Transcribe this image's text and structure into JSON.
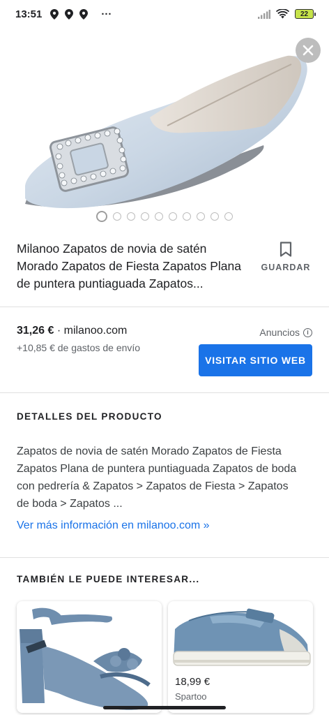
{
  "status_bar": {
    "time": "13:51",
    "more": "···",
    "battery": "22",
    "left_icons": [
      "location-pin-icon",
      "location-pin-icon",
      "location-pin-icon"
    ],
    "right_icons": [
      "signal-icon",
      "wifi-icon",
      "battery-icon"
    ]
  },
  "hero": {
    "image": "light-blue satin flat shoe with crystal buckle",
    "slide_count": 10,
    "active_slide": 1
  },
  "product": {
    "title": "Milanoo Zapatos de novia de satén Morado Zapatos de Fiesta Zapatos Plana de puntera puntiaguada Zapatos...",
    "save_label": "GUARDAR"
  },
  "offer": {
    "price": "31,26 €",
    "separator": " · ",
    "store": "milanoo.com",
    "shipping": "+10,85 € de gastos de envío",
    "ads_label": "Anuncios",
    "visit_label": "VISITAR SITIO WEB"
  },
  "details": {
    "heading": "DETALLES DEL PRODUCTO",
    "description": "Zapatos de novia de satén Morado Zapatos de Fiesta Zapatos Plana de puntera puntiaguada Zapatos de boda con pedrería & Zapatos > Zapatos de Fiesta > Zapatos de boda > Zapatos ...",
    "more_link": "Ver más información en milanoo.com »"
  },
  "also_interested": {
    "heading": "TAMBIÉN LE PUEDE INTERESAR...",
    "cards": [
      {
        "image": "blue suede block-heel sandal with flower",
        "price": "",
        "store": ""
      },
      {
        "image": "blue canvas mary-jane sneaker",
        "price": "18,99 €",
        "store": "Spartoo"
      }
    ]
  },
  "colors": {
    "accent": "#1a73e8",
    "shoe_satin": "#cdd9e6",
    "sandal_blue": "#6f8eae",
    "sneaker_blue": "#6f93b4"
  }
}
